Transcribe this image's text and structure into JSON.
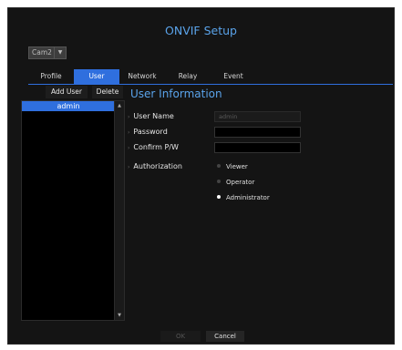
{
  "window": {
    "title": "ONVIF Setup"
  },
  "camera_select": {
    "value": "Cam2"
  },
  "tabs": [
    {
      "label": "Profile",
      "active": false
    },
    {
      "label": "User",
      "active": true
    },
    {
      "label": "Network",
      "active": false
    },
    {
      "label": "Relay",
      "active": false
    },
    {
      "label": "Event",
      "active": false
    }
  ],
  "list_actions": {
    "add_label": "Add User",
    "delete_label": "Delete"
  },
  "users": [
    "admin"
  ],
  "section": {
    "title": "User Information"
  },
  "form": {
    "user_name_label": "User Name",
    "user_name_value": "admin",
    "password_label": "Password",
    "password_value": "",
    "confirm_label": "Confirm P/W",
    "confirm_value": "",
    "authorization_label": "Authorization",
    "auth_options": [
      {
        "label": "Viewer",
        "selected": false
      },
      {
        "label": "Operator",
        "selected": false
      },
      {
        "label": "Administrator",
        "selected": true
      }
    ]
  },
  "footer": {
    "ok_label": "OK",
    "cancel_label": "Cancel"
  },
  "colors": {
    "accent": "#2f6fde",
    "title": "#5aa3ea",
    "background": "#141414"
  }
}
